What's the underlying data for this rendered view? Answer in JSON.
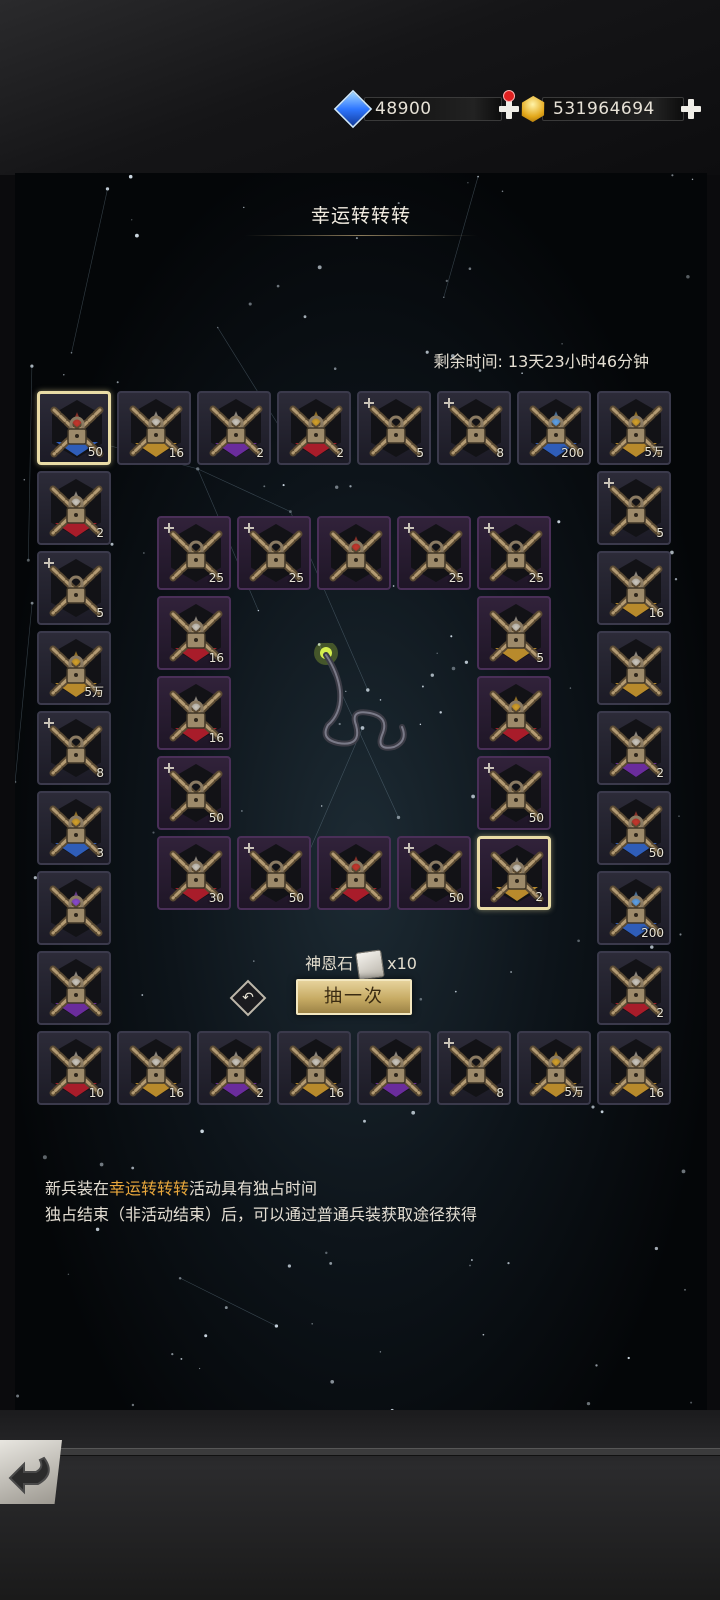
{
  "currency": {
    "gems": {
      "icon": "blue-gem-icon",
      "value": "48900"
    },
    "gold": {
      "icon": "gold-crystal-icon",
      "value": "531964694"
    }
  },
  "panel": {
    "title": "幸运转转转",
    "timer": "剩余时间: 13天23小时46分钟",
    "stone_label": "神恩石",
    "stone_count": "x10",
    "draw_button": "抽一次",
    "note_line1_pre": "新兵装在",
    "note_line1_hl": "幸运转转转",
    "note_line1_post": "活动具有独占时间",
    "note_line2": "独占结束（非活动结束）后，可以通过普通兵装获取途径获得"
  },
  "colors": {
    "accent_gold": "#e8a73c",
    "rarity_blue": "#2f5db8",
    "rarity_gold": "#b88a2c",
    "rarity_purple": "#6a2c9c",
    "rarity_red": "#a81c2a",
    "selection": "#e9dca6"
  },
  "outer_ring": [
    {
      "count": "50",
      "rarity": "blue",
      "gear": "red",
      "selected": true
    },
    {
      "count": "16",
      "rarity": "gold",
      "gear": "white",
      "selected": false
    },
    {
      "count": "2",
      "rarity": "purple",
      "gear": "white",
      "selected": false
    },
    {
      "count": "2",
      "rarity": "red",
      "gear": "gold",
      "selected": false
    },
    {
      "count": "5",
      "rarity": "none",
      "gear": "none",
      "selected": false
    },
    {
      "count": "8",
      "rarity": "none",
      "gear": "none",
      "selected": false
    },
    {
      "count": "200",
      "rarity": "blue",
      "gear": "blue",
      "selected": false
    },
    {
      "count": "5万",
      "rarity": "gold",
      "gear": "gold",
      "selected": false
    },
    {
      "count": "5",
      "rarity": "none",
      "gear": "none",
      "selected": false
    },
    {
      "count": "16",
      "rarity": "gold",
      "gear": "white",
      "selected": false
    },
    {
      "count": "",
      "rarity": "gold",
      "gear": "white",
      "selected": false
    },
    {
      "count": "2",
      "rarity": "purple",
      "gear": "white",
      "selected": false
    },
    {
      "count": "50",
      "rarity": "blue",
      "gear": "red",
      "selected": false
    },
    {
      "count": "200",
      "rarity": "blue",
      "gear": "blue",
      "selected": false
    },
    {
      "count": "2",
      "rarity": "red",
      "gear": "white",
      "selected": false
    },
    {
      "count": "16",
      "rarity": "gold",
      "gear": "white",
      "selected": false
    },
    {
      "count": "5万",
      "rarity": "gold",
      "gear": "gold",
      "selected": false
    },
    {
      "count": "8",
      "rarity": "none",
      "gear": "none",
      "selected": false
    },
    {
      "count": "",
      "rarity": "purple",
      "gear": "white",
      "selected": false
    },
    {
      "count": "16",
      "rarity": "gold",
      "gear": "white",
      "selected": false
    },
    {
      "count": "2",
      "rarity": "purple",
      "gear": "white",
      "selected": false
    },
    {
      "count": "16",
      "rarity": "gold",
      "gear": "white",
      "selected": false
    },
    {
      "count": "10",
      "rarity": "red",
      "gear": "white",
      "selected": false
    },
    {
      "count": "",
      "rarity": "purple",
      "gear": "white",
      "selected": false
    },
    {
      "count": "",
      "rarity": "none",
      "gear": "purple",
      "selected": false
    },
    {
      "count": "3",
      "rarity": "blue",
      "gear": "gold",
      "selected": false
    },
    {
      "count": "8",
      "rarity": "none",
      "gear": "none",
      "selected": false
    },
    {
      "count": "5万",
      "rarity": "gold",
      "gear": "gold",
      "selected": false
    },
    {
      "count": "5",
      "rarity": "none",
      "gear": "none",
      "selected": false
    },
    {
      "count": "2",
      "rarity": "red",
      "gear": "white",
      "selected": false
    }
  ],
  "inner_ring": [
    {
      "count": "25",
      "rarity": "none",
      "gear": "none",
      "selected": false
    },
    {
      "count": "25",
      "rarity": "none",
      "gear": "none",
      "selected": false
    },
    {
      "count": "",
      "rarity": "none",
      "gear": "red",
      "selected": false
    },
    {
      "count": "25",
      "rarity": "none",
      "gear": "none",
      "selected": false
    },
    {
      "count": "25",
      "rarity": "none",
      "gear": "none",
      "selected": false
    },
    {
      "count": "5",
      "rarity": "gold",
      "gear": "white",
      "selected": false
    },
    {
      "count": "",
      "rarity": "red",
      "gear": "gold",
      "selected": false
    },
    {
      "count": "50",
      "rarity": "none",
      "gear": "none",
      "selected": false
    },
    {
      "count": "2",
      "rarity": "gold",
      "gear": "white",
      "selected": true
    },
    {
      "count": "50",
      "rarity": "none",
      "gear": "none",
      "selected": false
    },
    {
      "count": "",
      "rarity": "red",
      "gear": "red",
      "selected": false
    },
    {
      "count": "50",
      "rarity": "none",
      "gear": "none",
      "selected": false
    },
    {
      "count": "30",
      "rarity": "red",
      "gear": "white",
      "selected": false
    },
    {
      "count": "50",
      "rarity": "none",
      "gear": "none",
      "selected": false
    },
    {
      "count": "16",
      "rarity": "red",
      "gear": "white",
      "selected": false
    },
    {
      "count": "16",
      "rarity": "red",
      "gear": "white",
      "selected": false
    }
  ]
}
